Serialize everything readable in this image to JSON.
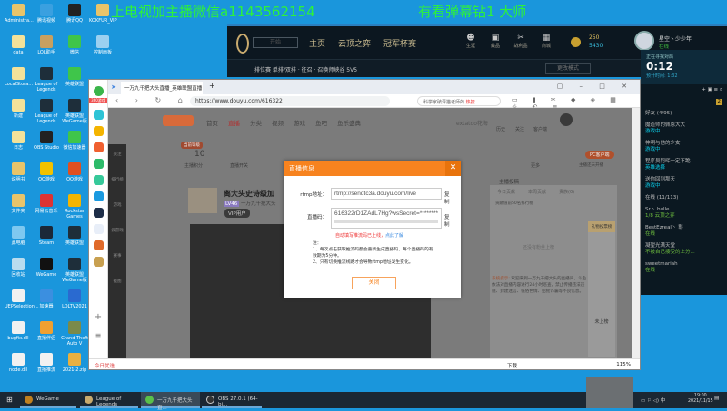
{
  "watermark": {
    "left": "上电视加主播微信a1143562154",
    "right": "有看弹幕钻1 大师"
  },
  "desktop_icons": [
    {
      "label": "Administra...",
      "color": "#e8c46a"
    },
    {
      "label": "data",
      "color": "#f3e29a"
    },
    {
      "label": "LocalStora...",
      "color": "#f3e29a"
    },
    {
      "label": "新建",
      "color": "#f3e29a"
    },
    {
      "label": "日志",
      "color": "#f3e29a"
    },
    {
      "label": "说明书",
      "color": "#e8c46a"
    },
    {
      "label": "文件夹",
      "color": "#e8c46a"
    },
    {
      "label": "此电脑",
      "color": "#7ec8f0"
    },
    {
      "label": "回收站",
      "color": "#b9dcef"
    },
    {
      "label": "UEPSelection...",
      "color": "#f1f1f1"
    },
    {
      "label": "bugfix.dll",
      "color": "#f1f1f1"
    },
    {
      "label": "node.dll",
      "color": "#f1f1f1"
    },
    {
      "label": "腾讯视频",
      "color": "#3aa0e0"
    },
    {
      "label": "LOL助手",
      "color": "#c8a060"
    },
    {
      "label": "League of Legends",
      "color": "#1e2e3a"
    },
    {
      "label": "League of Legends",
      "color": "#1e2e3a"
    },
    {
      "label": "OBS Studio",
      "color": "#222"
    },
    {
      "label": "QQ游戏",
      "color": "#f2c200"
    },
    {
      "label": "网易云音乐",
      "color": "#d33"
    },
    {
      "label": "Steam",
      "color": "#1b2838"
    },
    {
      "label": "WeGame",
      "color": "#111"
    },
    {
      "label": "加速器",
      "color": "#3b8fe0"
    },
    {
      "label": "直播伴侣",
      "color": "#f0a030"
    },
    {
      "label": "直播推流",
      "color": "#f1f1f1"
    },
    {
      "label": "腾讯QQ",
      "color": "#222"
    },
    {
      "label": "微信",
      "color": "#3fc54a"
    },
    {
      "label": "英雄联盟",
      "color": "#3fc54a"
    },
    {
      "label": "英雄联盟WeGame版",
      "color": "#1e2e3a"
    },
    {
      "label": "微信加速器",
      "color": "#3fc54a"
    },
    {
      "label": "QQ游戏",
      "color": "#e05020"
    },
    {
      "label": "Rockstar Games",
      "color": "#f2b500"
    },
    {
      "label": "英雄联盟",
      "color": "#1e2e3a"
    },
    {
      "label": "英雄联盟WeGame版",
      "color": "#1e2e3a"
    },
    {
      "label": "LOLTV2021",
      "color": "#2a6ad0"
    },
    {
      "label": "Grand Theft Auto V",
      "color": "#7a8a4a"
    },
    {
      "label": "2021-2.zip",
      "color": "#e8b040"
    },
    {
      "label": "KOKFUR_VIP",
      "color": "#e8c46a"
    },
    {
      "label": "控制面板",
      "color": "#9bd0f0"
    }
  ],
  "lol": {
    "play_label": "开始",
    "nav": [
      "主页",
      "云顶之弈",
      "冠军杯赛"
    ],
    "icons": [
      "生涯",
      "藏品",
      "战利品",
      "商城"
    ],
    "currency": {
      "be": "250",
      "rp": "5430"
    },
    "summoner": "星空丶少少年",
    "status": "在线",
    "lobby": "排位赛 单排/双排 · 征召 · 召唤师峡谷 5V5",
    "mode_button": "更改模式",
    "queue_title": "正在寻找对局",
    "timer": "0:12",
    "estimate": "预计时间: 1:32"
  },
  "chat": {
    "section1": "好友 (4/95)",
    "section2": "在线 (11/113)",
    "badge": "2",
    "friends": [
      {
        "name": "魔道师的佩恩大大",
        "status": "游戏中",
        "type": "s"
      },
      {
        "name": "神明与他的少女",
        "status": "游戏中",
        "type": "s"
      },
      {
        "name": "程序员阿晖一定不跪",
        "status": "英雄选择",
        "type": "s"
      },
      {
        "name": "送你回到那天",
        "status": "游戏中",
        "type": "s"
      },
      {
        "name": "Sr丶 bulle",
        "status": "1/8 云顶之弈",
        "type": "g"
      },
      {
        "name": "BestEzreal丶 彰",
        "status": "在线",
        "type": "g"
      },
      {
        "name": "凝望光满天堂",
        "status": "不被自己接受的上分...",
        "type": "g"
      },
      {
        "name": "sweetmariah",
        "status": "在线",
        "type": "g"
      }
    ]
  },
  "browser": {
    "tab_title": "一万九千把大头直播_英雄联盟直播",
    "url": "https://www.douyu.com/616322",
    "search_placeholder": "科学家破译猫老师的",
    "hot": "热搜",
    "sidebar_badge": "360游戏",
    "status_left": "今日优选",
    "zoom": "115%",
    "download": "下载",
    "page": {
      "nav": [
        "首页",
        "直播",
        "分类",
        "视频",
        "游戏",
        "鱼吧",
        "鱼乐盛典"
      ],
      "search_hint": "extatoo花海",
      "top_icons": [
        "历史",
        "关注",
        "客户端"
      ],
      "left_nav": [
        "关注",
        "排行榜",
        "游戏",
        "云游戏",
        "赛事",
        "截图"
      ],
      "score_badge": "当前等级",
      "score": "10",
      "score_label": "主播积分",
      "toggle_label": "直播开关",
      "more": "更多",
      "pc_client": "PC客户端",
      "pc_hint": "主播还未开播",
      "room_title": "离大头史诗级加",
      "room_tag": "LV46",
      "room_owner": "一万九千把大头",
      "vip": "VIP用户",
      "rank_tabs": [
        "今日贡献",
        "本周贡献",
        "贵族(0)"
      ],
      "rank_title": "贡献值前50名排行榜",
      "empty_rank": "还没有粉丝上榜",
      "anchor_rank": "主播投稿",
      "sys_label": "系统提示:",
      "sys_msg": "欢迎来到一万九千把大头的直播间，斗鱼依法对直播内容进行24小时巡查，禁止传播违法违规、封建迷信、低俗色情、招摇诈骗等不良信息。",
      "not_ranked": "未上榜",
      "gift": "礼物投票榜"
    }
  },
  "dialog": {
    "title": "直播信息",
    "rtmp_label": "rtmp地址：",
    "rtmp_value": "rtmp://sendtc3a.douyu.com/live",
    "code_label": "直播码：",
    "code_value": "616322rD1ZAdL7Hg?wsSecret=********",
    "copy": "复制",
    "warning": "自动填写推流码已上线，",
    "learn_more": "点此了解",
    "note_title": "注：",
    "note1": "1、每次点击获取推流码都会重新生成直播码，每个直播码的有效期为5分钟。",
    "note2": "2、只有切换推流线路才会导致rtmp地址发生变化。",
    "close": "关闭"
  },
  "taskbar": {
    "items": [
      "WeGame",
      "League of Legends",
      "一万九千把大头直...",
      "OBS 27.0.1 (64-bi..."
    ],
    "time": "19:00",
    "date": "2021/11/15",
    "ime": "中"
  },
  "colors": {
    "desktop": "#1a96dc",
    "douyu_orange": "#f7831f",
    "lol_gold": "#cdbe91",
    "watermark": "#2df23a"
  }
}
